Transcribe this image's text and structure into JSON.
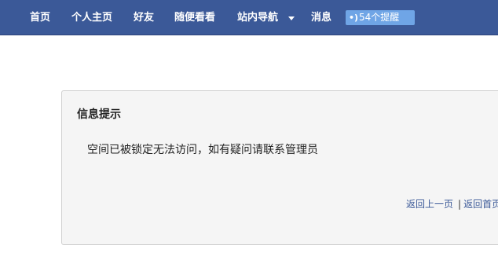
{
  "nav": {
    "items": [
      {
        "label": "首页"
      },
      {
        "label": "个人主页"
      },
      {
        "label": "好友"
      },
      {
        "label": "随便看看"
      },
      {
        "label": "站内导航"
      },
      {
        "label": "消息"
      }
    ],
    "notifications": {
      "count": "54",
      "label": "54个提醒"
    }
  },
  "notice": {
    "title": "信息提示",
    "message": "空间已被锁定无法访问，如有疑问请联系管理员",
    "links": {
      "back": "返回上一页",
      "separator": "|",
      "home": "返回首页"
    }
  },
  "colors": {
    "topbar": "#3b5998",
    "notification_badge": "#6fa5e6",
    "panel_background": "#f5f5f5",
    "link": "#3b5998"
  }
}
